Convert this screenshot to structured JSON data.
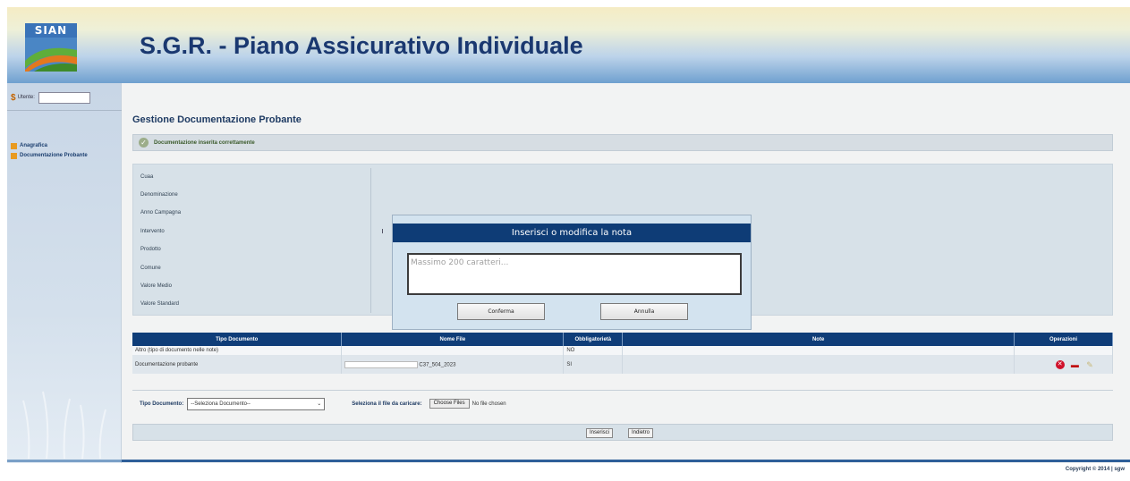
{
  "header": {
    "logo_text": "SIAN",
    "title": "S.G.R. - Piano Assicurativo Individuale"
  },
  "sidebar": {
    "user_label": "Utente:",
    "items": [
      {
        "label": "Anagrafica"
      },
      {
        "label": "Documentazione Probante"
      }
    ]
  },
  "main": {
    "section_title": "Gestione Documentazione Probante",
    "success_message": "Documentazione inserita correttamente",
    "info_labels": [
      "Cuaa",
      "Denominazione",
      "Anno Campagna",
      "Intervento",
      "Prodotto",
      "Comune",
      "Valore Medio",
      "Valore Standard"
    ]
  },
  "modal": {
    "title": "Inserisci o modifica la nota",
    "placeholder": "Massimo 200 caratteri...",
    "confirm_label": "Conferma",
    "cancel_label": "Annulla"
  },
  "table": {
    "headers": [
      "Tipo Documento",
      "Nome File",
      "Obbligatorietà",
      "Note",
      "Operazioni"
    ],
    "rows": [
      {
        "tipo": "Altro (tipo di documento nelle note)",
        "file": "",
        "obbl": "NO",
        "note": ""
      },
      {
        "tipo": "Documentazione probante",
        "file": "C37_504_2023",
        "obbl": "SI",
        "note": ""
      }
    ],
    "operation_icons": [
      "delete-icon",
      "pdf-icon",
      "edit-note-icon"
    ]
  },
  "upload": {
    "doc_type_label": "Tipo Documento:",
    "doc_type_selected": "--Seleziona Documento--",
    "file_label": "Seleziona il file da caricare:",
    "choose_label": "Choose Files",
    "no_file_text": "No file chosen"
  },
  "actions": {
    "insert_label": "Inserisci",
    "back_label": "Indietro"
  },
  "footer": {
    "copyright": "Copyright © 2014 | sgw"
  },
  "colors": {
    "header_navy": "#0f3d78",
    "title_blue": "#1a3870",
    "sidebar_bullet": "#e89a20",
    "delete_red": "#d0112b"
  }
}
